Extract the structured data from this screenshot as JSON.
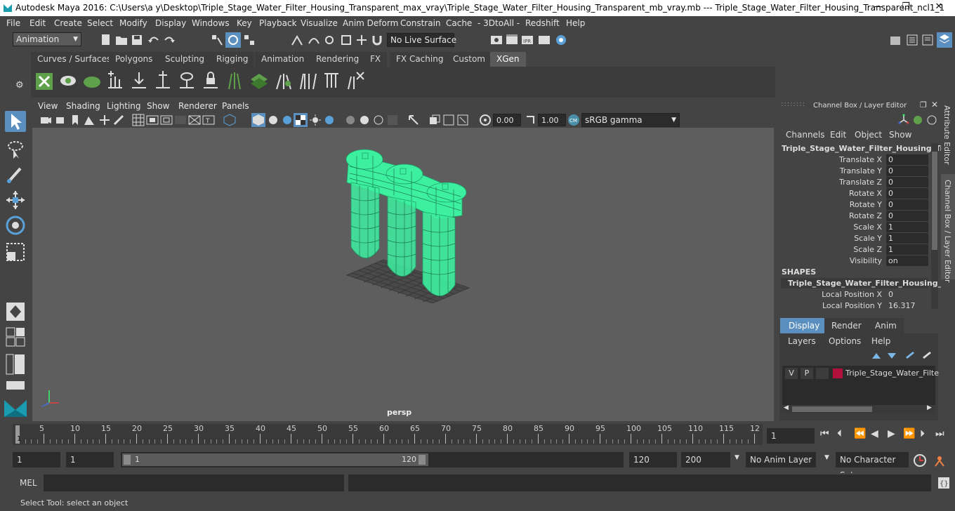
{
  "window": {
    "title": "Autodesk Maya 2016: C:\\Users\\a y\\Desktop\\Triple_Stage_Water_Filter_Housing_Transparent_max_vray\\Triple_Stage_Water_Filter_Housing_Transparent_mb_vray.mb   ---   Triple_Stage_Water_Filter_Housing_Transparent_ncl1_1",
    "minimize": "—",
    "restore": "❐",
    "close": "✕"
  },
  "menu": [
    "File",
    "Edit",
    "Create",
    "Select",
    "Modify",
    "Display",
    "Windows",
    "Key",
    "Playback",
    "Visualize",
    "Anim Deform",
    "Constrain",
    "Cache",
    "- 3DtoAll -",
    "Redshift",
    "Help"
  ],
  "status_line": {
    "menuset": "Animation",
    "live_surface": "No Live Surface"
  },
  "shelf_tabs": [
    "Curves / Surfaces",
    "Polygons",
    "Sculpting",
    "Rigging",
    "Animation",
    "Rendering",
    "FX",
    "FX Caching",
    "Custom",
    "XGen"
  ],
  "shelf_active": "XGen",
  "panel_menu": [
    "View",
    "Shading",
    "Lighting",
    "Show",
    "Renderer",
    "Panels"
  ],
  "panel_toolbar": {
    "exposure": "0.00",
    "gamma": "1.00",
    "color_space": "sRGB gamma"
  },
  "viewport": {
    "camera_label": "persp"
  },
  "channel_box": {
    "header": "Channel Box / Layer Editor",
    "menus": [
      "Channels",
      "Edit",
      "Object",
      "Show"
    ],
    "object_name": "Triple_Stage_Water_Filter_Housing_Tr...",
    "attributes": [
      {
        "label": "Translate X",
        "value": "0"
      },
      {
        "label": "Translate Y",
        "value": "0"
      },
      {
        "label": "Translate Z",
        "value": "0"
      },
      {
        "label": "Rotate X",
        "value": "0"
      },
      {
        "label": "Rotate Y",
        "value": "0"
      },
      {
        "label": "Rotate Z",
        "value": "0"
      },
      {
        "label": "Scale X",
        "value": "1"
      },
      {
        "label": "Scale Y",
        "value": "1"
      },
      {
        "label": "Scale Z",
        "value": "1"
      },
      {
        "label": "Visibility",
        "value": "on"
      }
    ],
    "shapes_header": "SHAPES",
    "shape_name": "Triple_Stage_Water_Filter_Housing_...",
    "shape_attributes": [
      {
        "label": "Local Position X",
        "value": "0"
      },
      {
        "label": "Local Position Y",
        "value": "16.317"
      }
    ]
  },
  "layer_editor": {
    "tabs": [
      "Display",
      "Render",
      "Anim"
    ],
    "active_tab": "Display",
    "menus": [
      "Layers",
      "Options",
      "Help"
    ],
    "layer": {
      "v": "V",
      "p": "P",
      "name": "Triple_Stage_Water_Filte",
      "color": "#b0103a"
    }
  },
  "side_tabs": [
    "Attribute Editor",
    "Channel Box / Layer Editor"
  ],
  "time_slider": {
    "ticks": [
      "5",
      "10",
      "15",
      "20",
      "25",
      "30",
      "35",
      "40",
      "45",
      "50",
      "55",
      "60",
      "65",
      "70",
      "75",
      "80",
      "85",
      "90",
      "95",
      "100",
      "105",
      "110",
      "115",
      "12"
    ],
    "current_frame_marker": "1",
    "current_frame": "1"
  },
  "range_slider": {
    "start": "1",
    "playback_start": "1",
    "range_start": "1",
    "range_end": "120",
    "playback_end": "120",
    "end": "200",
    "anim_layer": "No Anim Layer",
    "character_set": "No Character Set"
  },
  "command_line": {
    "label": "MEL"
  },
  "help_line": "Select Tool: select an object",
  "colors": {
    "wireframe": "#3df0a0",
    "accent": "#5a8fc0"
  }
}
